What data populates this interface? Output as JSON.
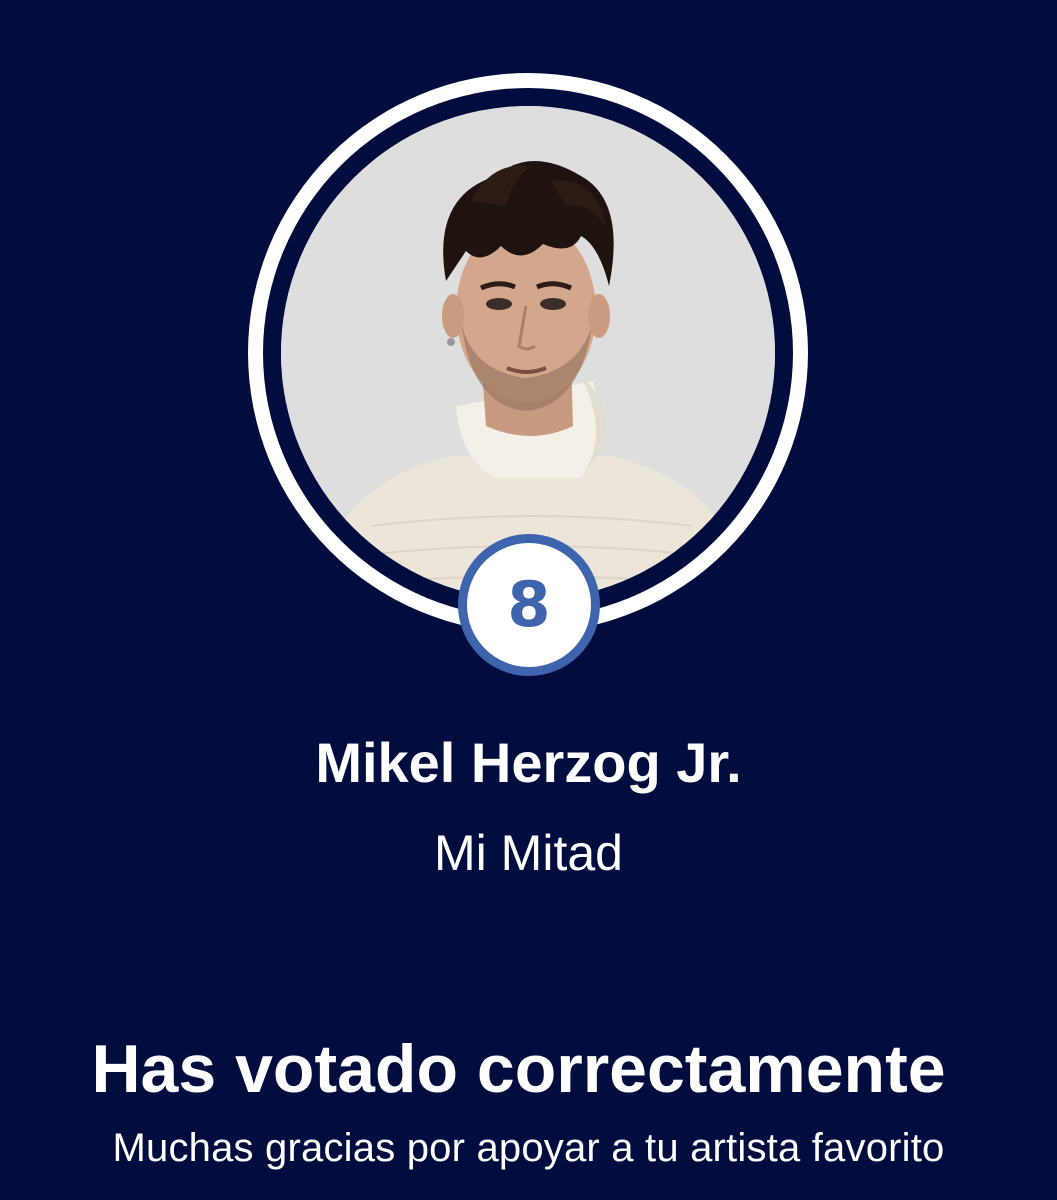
{
  "candidate": {
    "number": "8",
    "artist_name": "Mikel Herzog Jr.",
    "song_title": "Mi Mitad",
    "photo_icon": "artist-portrait"
  },
  "confirmation": {
    "title": "Has votado correctamente",
    "message": "Muchas gracias por apoyar a tu artista favorito"
  },
  "colors": {
    "background": "#020d3f",
    "ring": "#ffffff",
    "badge_accent": "#3e64ae",
    "photo_backdrop": "#dedede"
  }
}
